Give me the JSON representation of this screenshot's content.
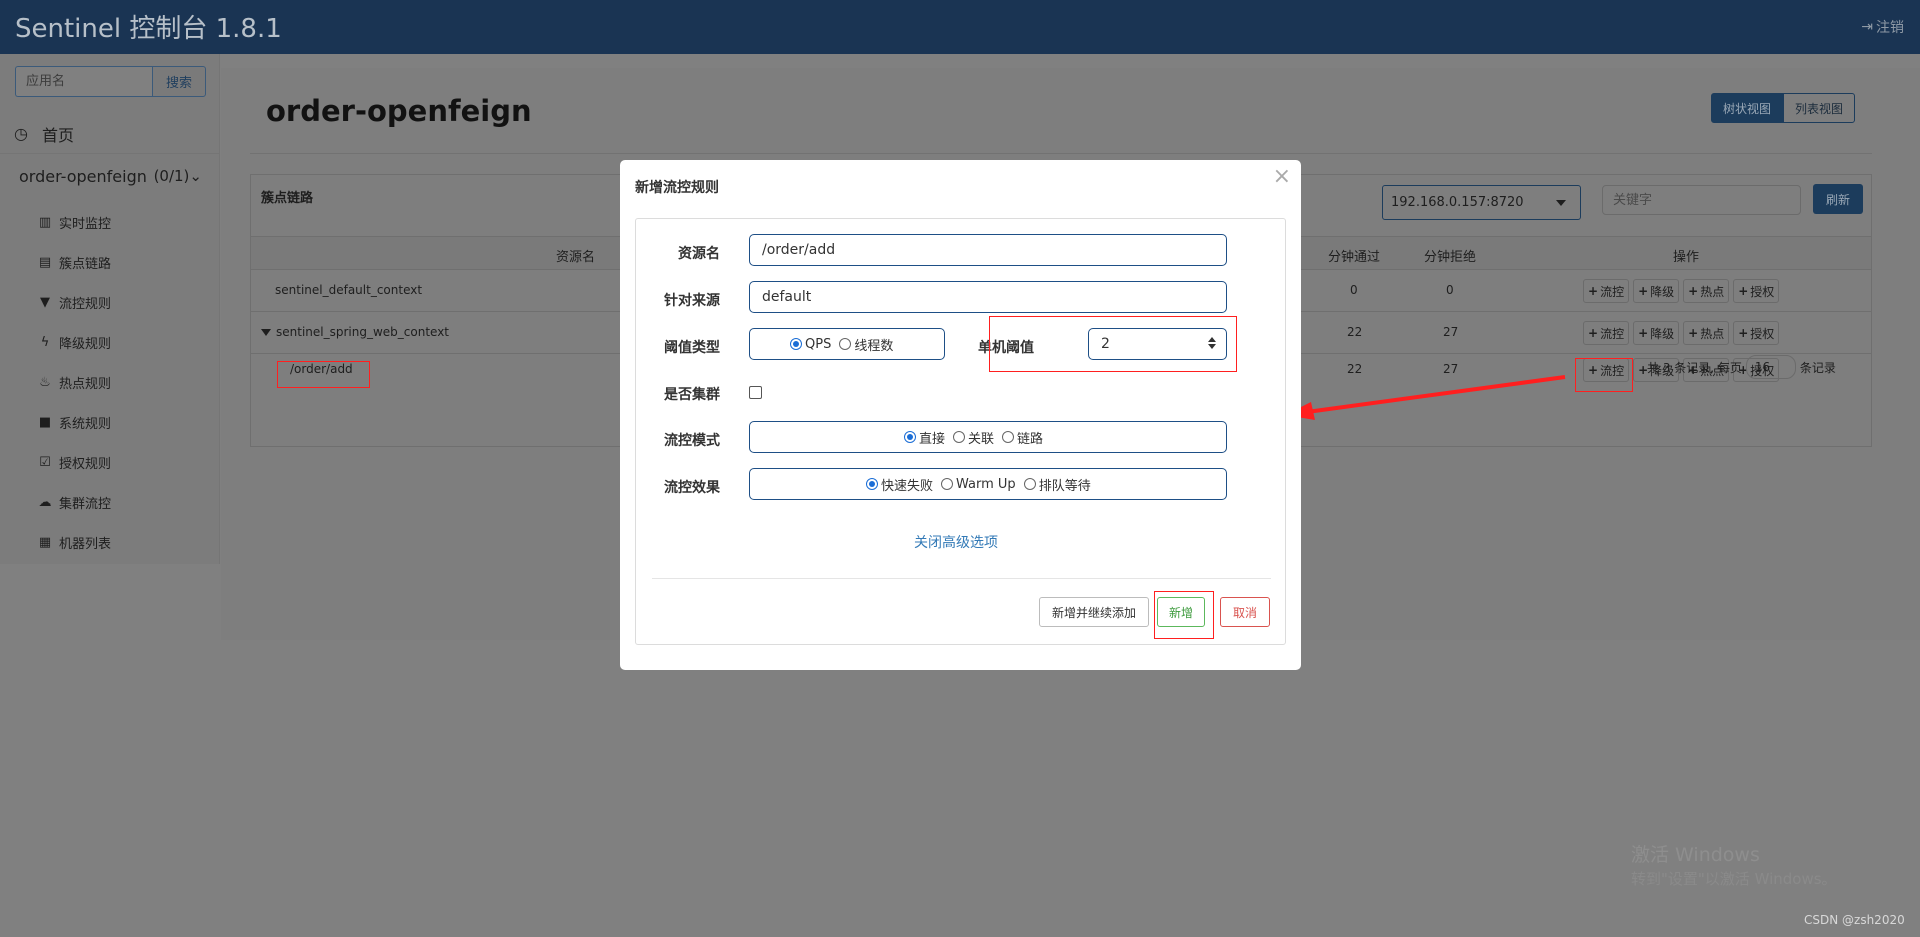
{
  "header": {
    "brand": "Sentinel 控制台 1.8.1",
    "logout_label": "注销"
  },
  "sidebar": {
    "search_placeholder": "应用名",
    "search_button": "搜索",
    "home_label": "首页",
    "app_name": "order-openfeign",
    "app_count": "(0/1)",
    "items": [
      {
        "label": "实时监控",
        "icon": "bar-chart-icon"
      },
      {
        "label": "簇点链路",
        "icon": "list-icon"
      },
      {
        "label": "流控规则",
        "icon": "filter-icon"
      },
      {
        "label": "降级规则",
        "icon": "flash-icon"
      },
      {
        "label": "热点规则",
        "icon": "fire-icon"
      },
      {
        "label": "系统规则",
        "icon": "lock-icon"
      },
      {
        "label": "授权规则",
        "icon": "check-icon"
      },
      {
        "label": "集群流控",
        "icon": "cloud-icon"
      },
      {
        "label": "机器列表",
        "icon": "grid-icon"
      }
    ]
  },
  "main": {
    "title": "order-openfeign",
    "view_tree": "树状视图",
    "view_list": "列表视图",
    "panel_title": "簇点链路",
    "machine": "192.168.0.157:8720",
    "keyword_placeholder": "关键字",
    "refresh": "刷新",
    "columns": {
      "resource": "资源名",
      "pass": "分钟通过",
      "block": "分钟拒绝",
      "ops": "操作"
    },
    "rows": [
      {
        "name": "sentinel_default_context",
        "pass": "0",
        "block": "0"
      },
      {
        "name": "sentinel_spring_web_context",
        "pass": "22",
        "block": "27"
      },
      {
        "name": "/order/add",
        "pass": "22",
        "block": "27"
      }
    ],
    "op_labels": {
      "flow": "流控",
      "degrade": "降级",
      "hot": "热点",
      "auth": "授权"
    },
    "pager": {
      "prefix": "共 3 条记录, 每页",
      "size": "16",
      "suffix": "条记录"
    }
  },
  "modal": {
    "title": "新增流控规则",
    "close": "×",
    "fields": {
      "resource_label": "资源名",
      "resource_value": "/order/add",
      "source_label": "针对来源",
      "source_value": "default",
      "threshold_type_label": "阈值类型",
      "qps": "QPS",
      "threads": "线程数",
      "single_threshold_label": "单机阈值",
      "single_threshold_value": "2",
      "cluster_label": "是否集群",
      "mode_label": "流控模式",
      "mode_direct": "直接",
      "mode_assoc": "关联",
      "mode_chain": "链路",
      "effect_label": "流控效果",
      "effect_fast": "快速失败",
      "effect_warm": "Warm Up",
      "effect_queue": "排队等待"
    },
    "advanced_link": "关闭高级选项",
    "buttons": {
      "add_continue": "新增并继续添加",
      "add": "新增",
      "cancel": "取消"
    }
  },
  "watermark": {
    "line1": "激活 Windows",
    "line2": "转到\"设置\"以激活 Windows。"
  },
  "credit": "CSDN @zsh2020",
  "colors": {
    "accent": "#1e4f86",
    "annotation": "#ff1f1f",
    "ok": "#5cb85c",
    "danger": "#d9534f"
  }
}
